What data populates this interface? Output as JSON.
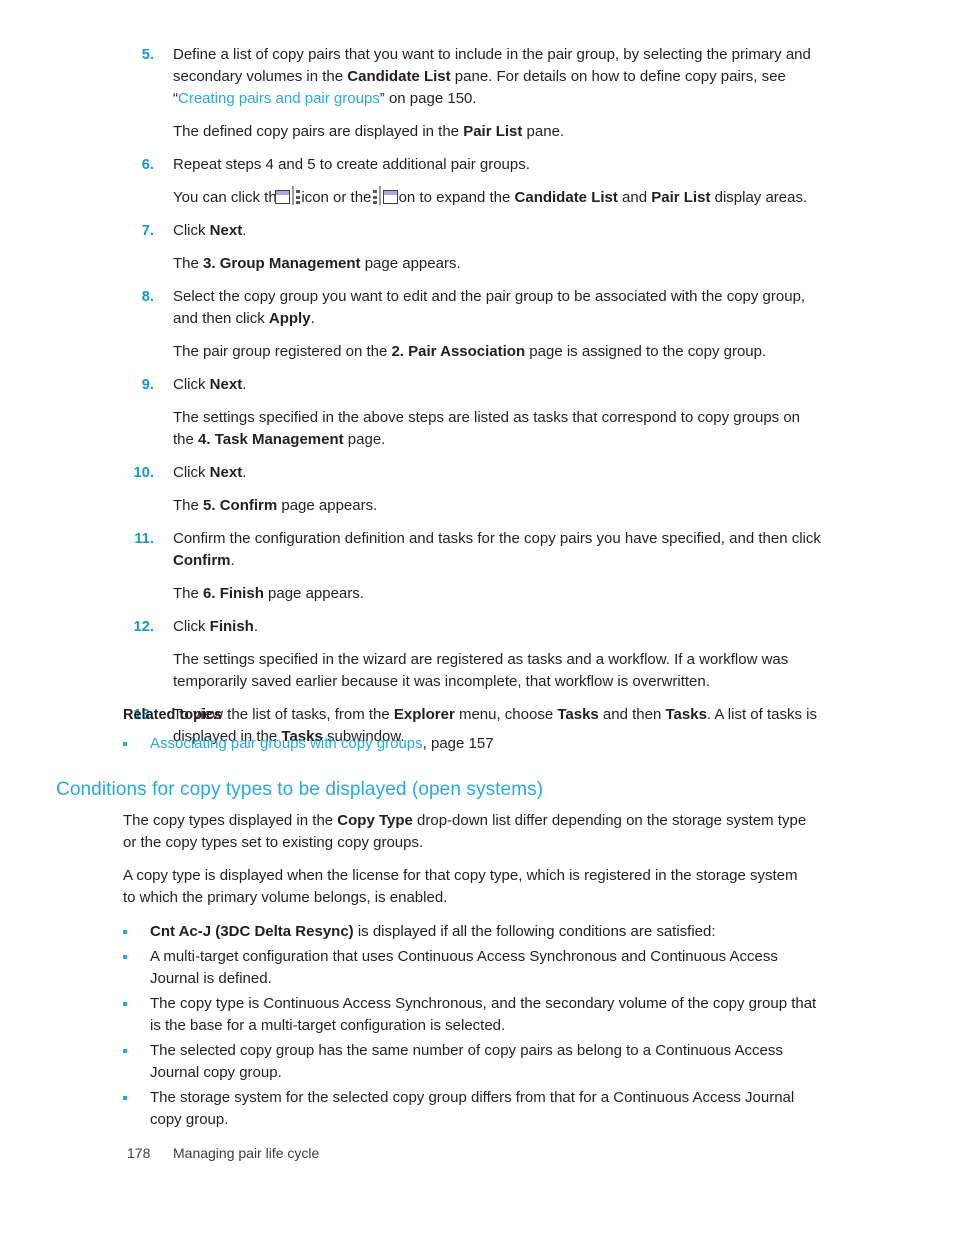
{
  "document": {
    "page_number": "178",
    "footer_title": "Managing pair life cycle",
    "accent_color": "#29a8e0",
    "number_color": "#1196d4",
    "text_color": "#231f20"
  },
  "steps": [
    {
      "num": "5.",
      "parts": [
        {
          "t": "text",
          "v": "Define a list of copy pairs that you want to include in the pair group, by selecting the primary and secondary volumes in the "
        },
        {
          "t": "bold",
          "v": "Candidate List"
        },
        {
          "t": "text",
          "v": " pane. For details on how to define copy pairs, see “"
        },
        {
          "t": "link",
          "v": "Creating pairs and pair groups"
        },
        {
          "t": "text",
          "v": "” on page 150."
        }
      ],
      "follow": [
        [
          {
            "t": "text",
            "v": "The defined copy pairs are displayed in the "
          },
          {
            "t": "bold",
            "v": "Pair List"
          },
          {
            "t": "text",
            "v": " pane."
          }
        ]
      ]
    },
    {
      "num": "6.",
      "parts": [
        {
          "t": "text",
          "v": "Repeat steps 4 and 5 to create additional pair groups."
        }
      ],
      "follow": [
        [
          {
            "t": "text",
            "v": "You can click the "
          },
          {
            "t": "icon",
            "v": "expand-candidate-list-icon"
          },
          {
            "t": "text",
            "v": " icon or the "
          },
          {
            "t": "icon",
            "v": "expand-pair-list-icon"
          },
          {
            "t": "text",
            "v": " icon to expand the "
          },
          {
            "t": "bold",
            "v": "Candidate List"
          },
          {
            "t": "text",
            "v": " and "
          },
          {
            "t": "bold",
            "v": "Pair List"
          },
          {
            "t": "text",
            "v": " display areas."
          }
        ]
      ]
    },
    {
      "num": "7.",
      "parts": [
        {
          "t": "text",
          "v": "Click "
        },
        {
          "t": "bold",
          "v": "Next"
        },
        {
          "t": "text",
          "v": "."
        }
      ],
      "follow": [
        [
          {
            "t": "text",
            "v": "The "
          },
          {
            "t": "bold",
            "v": "3. Group Management"
          },
          {
            "t": "text",
            "v": " page appears."
          }
        ]
      ]
    },
    {
      "num": "8.",
      "parts": [
        {
          "t": "text",
          "v": "Select the copy group you want to edit and the pair group to be associated with the copy group, and then click "
        },
        {
          "t": "bold",
          "v": "Apply"
        },
        {
          "t": "text",
          "v": "."
        }
      ],
      "follow": [
        [
          {
            "t": "text",
            "v": "The pair group registered on the "
          },
          {
            "t": "bold",
            "v": "2. Pair Association"
          },
          {
            "t": "text",
            "v": " page is assigned to the copy group."
          }
        ]
      ]
    },
    {
      "num": "9.",
      "parts": [
        {
          "t": "text",
          "v": "Click "
        },
        {
          "t": "bold",
          "v": "Next"
        },
        {
          "t": "text",
          "v": "."
        }
      ],
      "follow": [
        [
          {
            "t": "text",
            "v": "The settings specified in the above steps are listed as tasks that correspond to copy groups on the "
          },
          {
            "t": "bold",
            "v": "4. Task Management"
          },
          {
            "t": "text",
            "v": " page."
          }
        ]
      ]
    },
    {
      "num": "10.",
      "parts": [
        {
          "t": "text",
          "v": "Click "
        },
        {
          "t": "bold",
          "v": "Next"
        },
        {
          "t": "text",
          "v": "."
        }
      ],
      "follow": [
        [
          {
            "t": "text",
            "v": "The "
          },
          {
            "t": "bold",
            "v": "5. Confirm"
          },
          {
            "t": "text",
            "v": " page appears."
          }
        ]
      ]
    },
    {
      "num": "11.",
      "parts": [
        {
          "t": "text",
          "v": "Confirm the configuration definition and tasks for the copy pairs you have specified, and then click "
        },
        {
          "t": "bold",
          "v": "Confirm"
        },
        {
          "t": "text",
          "v": "."
        }
      ],
      "follow": [
        [
          {
            "t": "text",
            "v": "The "
          },
          {
            "t": "bold",
            "v": "6. Finish"
          },
          {
            "t": "text",
            "v": " page appears."
          }
        ]
      ]
    },
    {
      "num": "12.",
      "parts": [
        {
          "t": "text",
          "v": "Click "
        },
        {
          "t": "bold",
          "v": "Finish"
        },
        {
          "t": "text",
          "v": "."
        }
      ],
      "follow": [
        [
          {
            "t": "text",
            "v": "The settings specified in the wizard are registered as tasks and a workflow. If a workflow was temporarily saved earlier because it was incomplete, that workflow is overwritten."
          }
        ]
      ]
    },
    {
      "num": "13.",
      "parts": [
        {
          "t": "text",
          "v": "To view the list of tasks, from the "
        },
        {
          "t": "bold",
          "v": "Explorer"
        },
        {
          "t": "text",
          "v": " menu, choose "
        },
        {
          "t": "bold",
          "v": "Tasks"
        },
        {
          "t": "text",
          "v": " and then "
        },
        {
          "t": "bold",
          "v": "Tasks"
        },
        {
          "t": "text",
          "v": ". A list of tasks is displayed in the "
        },
        {
          "t": "bold",
          "v": "Tasks"
        },
        {
          "t": "text",
          "v": " subwindow."
        }
      ],
      "follow": []
    }
  ],
  "related": {
    "title": "Related topics",
    "items": [
      {
        "parts": [
          {
            "t": "link",
            "v": "Associating pair groups with copy groups"
          },
          {
            "t": "text",
            "v": ", page 157"
          }
        ]
      }
    ]
  },
  "section": {
    "heading": "Conditions for copy types to be displayed (open systems)",
    "paragraphs": [
      [
        {
          "t": "text",
          "v": "The copy types displayed in the "
        },
        {
          "t": "bold",
          "v": "Copy Type"
        },
        {
          "t": "text",
          "v": " drop-down list differ depending on the storage system type or the copy types set to existing copy groups."
        }
      ],
      [
        {
          "t": "text",
          "v": "A copy type is displayed when the license for that copy type, which is registered in the storage system to which the primary volume belongs, is enabled."
        }
      ]
    ],
    "conditions": [
      {
        "parts": [
          {
            "t": "bold",
            "v": "Cnt Ac-J (3DC Delta Resync)"
          },
          {
            "t": "text",
            "v": " is displayed if all the following conditions are satisfied:"
          }
        ]
      },
      {
        "parts": [
          {
            "t": "text",
            "v": "A multi-target configuration that uses Continuous Access Synchronous and Continuous Access Journal is defined."
          }
        ]
      },
      {
        "parts": [
          {
            "t": "text",
            "v": "The copy type is Continuous Access Synchronous, and the secondary volume of the copy group that is the base for a multi-target configuration is selected."
          }
        ]
      },
      {
        "parts": [
          {
            "t": "text",
            "v": "The selected copy group has the same number of copy pairs as belong to a Continuous Access Journal copy group."
          }
        ]
      },
      {
        "parts": [
          {
            "t": "text",
            "v": "The storage system for the selected copy group differs from that for a Continuous Access Journal copy group."
          }
        ]
      }
    ]
  }
}
